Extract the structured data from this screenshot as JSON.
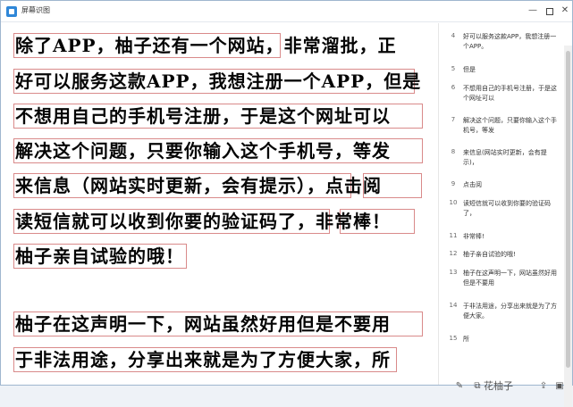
{
  "window": {
    "title": "屏幕识图"
  },
  "ocr": {
    "lines": [
      "除了APP，柚子还有一个网站，非常溜批，正",
      "好可以服务这款APP，我想注册一个APP，但是",
      "不想用自己的手机号注册，于是这个网址可以",
      "解决这个问题，只要你输入这个手机号，等发",
      "来信息（网站实时更新，会有提示），点击阅",
      "读短信就可以收到你要的验证码了，非常棒！",
      "柚子亲自试验的哦！",
      "",
      "柚子在这声明一下，网站虽然好用但是不要用",
      "于非法用途，分享出来就是为了方便大家，所"
    ]
  },
  "list": [
    {
      "num": "4",
      "text": "好可以服务这款APP，我想注册一个APP。"
    },
    {
      "num": "5",
      "text": "但是"
    },
    {
      "num": "6",
      "text": "不想用自己的手机号注册，于是这个网址可以"
    },
    {
      "num": "7",
      "text": "解决这个问题，只要你输入这个手机号，等发"
    },
    {
      "num": "8",
      "text": "来信息(网站实时更新，会有提示)，"
    },
    {
      "num": "9",
      "text": "点击阅"
    },
    {
      "num": "10",
      "text": "读短信就可以收到你要的验证码了，"
    },
    {
      "num": "11",
      "text": "非常棒!"
    },
    {
      "num": "12",
      "text": "柚子亲自试验的哦!"
    },
    {
      "num": "13",
      "text": "柚子在这声明一下，网站虽然好用但是不要用"
    },
    {
      "num": "14",
      "text": "于非法用途，分享出来就是为了方便大家。"
    },
    {
      "num": "15",
      "text": "所"
    }
  ],
  "footer": {
    "brand": "花柚子"
  }
}
